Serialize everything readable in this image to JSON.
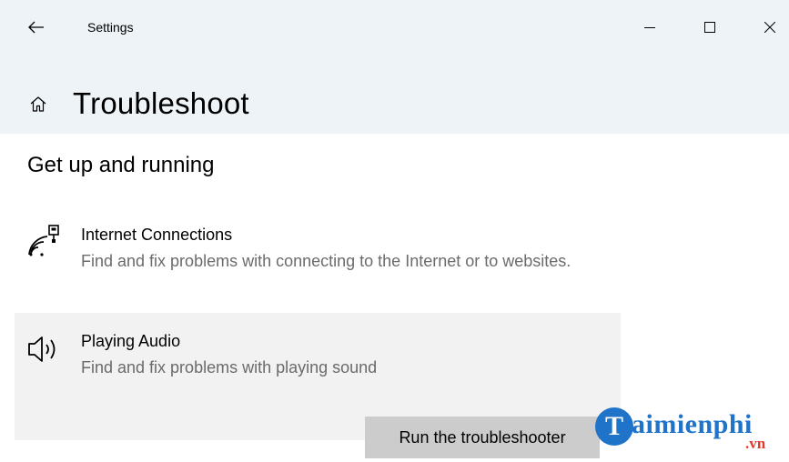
{
  "window": {
    "title": "Settings",
    "minimize_icon": "minimize-icon",
    "maximize_icon": "maximize-icon",
    "close_icon": "close-icon"
  },
  "page": {
    "title": "Troubleshoot",
    "home_icon": "home-icon",
    "back_icon": "back-arrow-icon"
  },
  "section": {
    "title": "Get up and running"
  },
  "troubleshooters": [
    {
      "name": "Internet Connections",
      "description": "Find and fix problems with connecting to the Internet or to websites.",
      "icon": "wifi-network-icon"
    },
    {
      "name": "Playing Audio",
      "description": "Find and fix problems with playing sound",
      "icon": "speaker-icon",
      "button_label": "Run the troubleshooter",
      "selected": true
    }
  ],
  "watermark": {
    "logo_letter": "T",
    "name": "aimienphi",
    "domain": ".vn"
  },
  "colors": {
    "header_background": "#eef3f8",
    "selected_background": "#f2f2f2",
    "button_background": "#cccccc",
    "watermark_blue": "#1f73c8",
    "watermark_red": "#e23a2c"
  }
}
